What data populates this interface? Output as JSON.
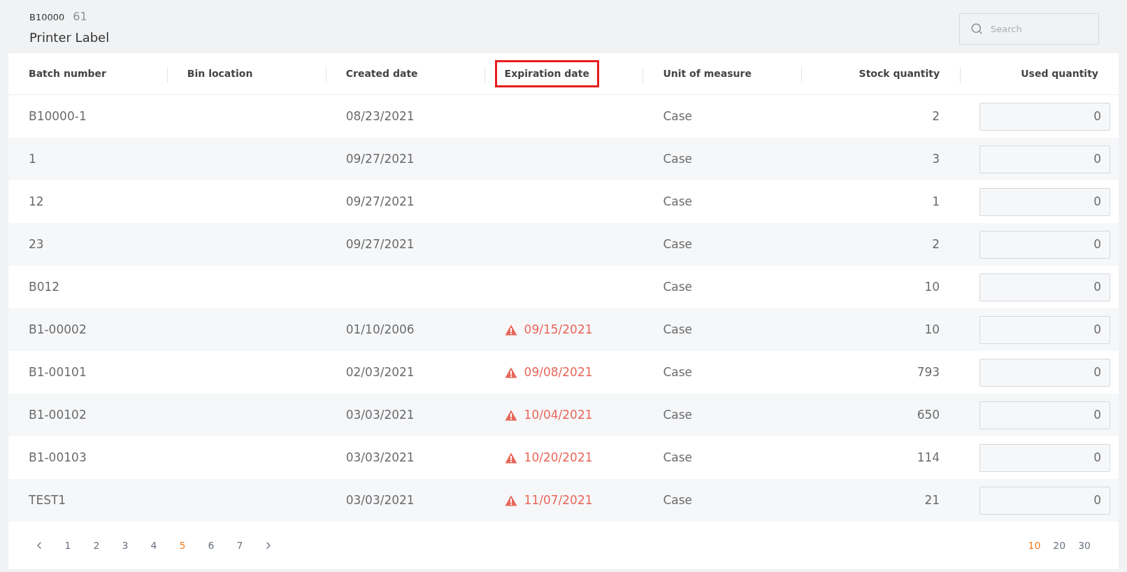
{
  "header": {
    "code": "B10000",
    "count": "61",
    "title": "Printer Label"
  },
  "search": {
    "placeholder": "Search"
  },
  "table": {
    "columns": [
      {
        "label": "Batch number",
        "highlighted": false
      },
      {
        "label": "Bin location",
        "highlighted": false
      },
      {
        "label": "Created date",
        "highlighted": false
      },
      {
        "label": "Expiration date",
        "highlighted": true
      },
      {
        "label": "Unit of measure",
        "highlighted": false
      },
      {
        "label": "Stock quantity",
        "highlighted": false
      },
      {
        "label": "Used quantity",
        "highlighted": false
      }
    ],
    "rows": [
      {
        "batch": "B10000-1",
        "created": "08/23/2021",
        "unit": "Case",
        "stock": "2",
        "used": "0"
      },
      {
        "batch": "1",
        "created": "09/27/2021",
        "unit": "Case",
        "stock": "3",
        "used": "0"
      },
      {
        "batch": "12",
        "created": "09/27/2021",
        "unit": "Case",
        "stock": "1",
        "used": "0"
      },
      {
        "batch": "23",
        "created": "09/27/2021",
        "unit": "Case",
        "stock": "2",
        "used": "0"
      },
      {
        "batch": "B012",
        "unit": "Case",
        "stock": "10",
        "used": "0"
      },
      {
        "batch": "B1-00002",
        "created": "01/10/2006",
        "expiration": "09/15/2021",
        "expired": true,
        "unit": "Case",
        "stock": "10",
        "used": "0"
      },
      {
        "batch": "B1-00101",
        "created": "02/03/2021",
        "expiration": "09/08/2021",
        "expired": true,
        "unit": "Case",
        "stock": "793",
        "used": "0"
      },
      {
        "batch": "B1-00102",
        "created": "03/03/2021",
        "expiration": "10/04/2021",
        "expired": true,
        "unit": "Case",
        "stock": "650",
        "used": "0"
      },
      {
        "batch": "B1-00103",
        "created": "03/03/2021",
        "expiration": "10/20/2021",
        "expired": true,
        "unit": "Case",
        "stock": "114",
        "used": "0"
      },
      {
        "batch": "TEST1",
        "created": "03/03/2021",
        "expiration": "11/07/2021",
        "expired": true,
        "unit": "Case",
        "stock": "21",
        "used": "0"
      }
    ]
  },
  "pagination": {
    "pages": [
      {
        "label": "1",
        "selected": false
      },
      {
        "label": "2",
        "selected": false
      },
      {
        "label": "3",
        "selected": false
      },
      {
        "label": "4",
        "selected": false
      },
      {
        "label": "5",
        "selected": true
      },
      {
        "label": "6",
        "selected": false
      },
      {
        "label": "7",
        "selected": false
      }
    ],
    "page_sizes": [
      {
        "label": "10",
        "selected": true
      },
      {
        "label": "20",
        "selected": false
      },
      {
        "label": "30",
        "selected": false
      }
    ]
  }
}
